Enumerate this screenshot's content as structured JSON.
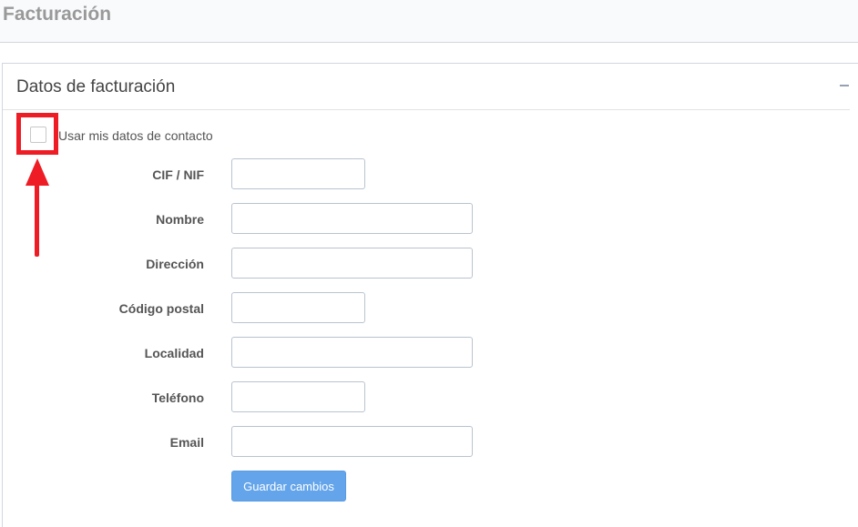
{
  "page": {
    "title": "Facturación"
  },
  "box": {
    "title": "Datos de facturación",
    "collapse_icon": "minus-icon"
  },
  "form": {
    "use_contact_label": "Usar mis datos de contacto",
    "use_contact_checked": false,
    "fields": [
      {
        "label": "CIF / NIF",
        "value": "",
        "placeholder": ""
      },
      {
        "label": "Nombre",
        "value": "",
        "placeholder": ""
      },
      {
        "label": "Dirección",
        "value": "",
        "placeholder": ""
      },
      {
        "label": "Código postal",
        "value": "",
        "placeholder": ""
      },
      {
        "label": "Localidad",
        "value": "",
        "placeholder": ""
      },
      {
        "label": "Teléfono",
        "value": "",
        "placeholder": ""
      },
      {
        "label": "Email",
        "value": "",
        "placeholder": ""
      }
    ],
    "save_label": "Guardar cambios"
  },
  "annotation": {
    "color": "#ee1c25",
    "icon": "arrow-up-icon"
  },
  "colors": {
    "primary_button": "#63a4eb",
    "header_background": "#f9fafc",
    "title_gray": "#999999"
  }
}
